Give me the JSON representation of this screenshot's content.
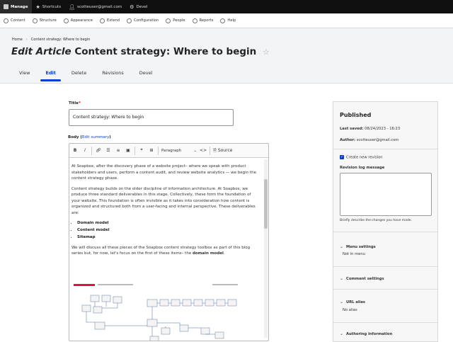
{
  "toolbar": {
    "manage": "Manage",
    "shortcuts": "Shortcuts",
    "user": "scotteuser@gmail.com",
    "devel": "Devel"
  },
  "tray": {
    "items": [
      "Content",
      "Structure",
      "Appearance",
      "Extend",
      "Configuration",
      "People",
      "Reports",
      "Help"
    ]
  },
  "header": {
    "breadcrumb": [
      "Home",
      "Content strategy: Where to begin"
    ],
    "title_prefix": "Edit Article",
    "title": "Content strategy: Where to begin",
    "tabs": [
      "View",
      "Edit",
      "Delete",
      "Revisions",
      "Devel"
    ],
    "active_tab": "Edit"
  },
  "form": {
    "title_label": "Title",
    "title_required": "*",
    "title_value": "Content strategy: Where to begin",
    "body_label": "Body",
    "edit_summary": "Edit summary",
    "format_value": "Paragraph",
    "source_label": "Source",
    "body": {
      "p1": "At Soapbox, after the discovery phase of a website project– where we speak with product stakeholders and users, perform a content audit, and review website analytics — we begin the content strategy phase.",
      "p2": "Content strategy builds on the older discipline of information architecture. At Soapbox, we produce three standard deliverables in this stage. Collectively, these form the foundation of your website. This foundation is often invisible as it takes into consideration how content is organized and structured both from a user-facing and internal perspective. These deliverables are:",
      "list": [
        "Domain model",
        "Content model",
        "Sitemap"
      ],
      "p3_start": "We will discuss all these pieces of the Soapbox content strategy toolbox as part of this blog series but, for now, let's focus on the first of these items– the",
      "p3_bold": "domain model",
      "p3_end": "."
    }
  },
  "sidebar": {
    "status": "Published",
    "last_saved_label": "Last saved:",
    "last_saved": "08/24/2023 - 16:23",
    "author_label": "Author:",
    "author": "scotteuser@gmail.com",
    "create_revision": "Create new revision",
    "revision_log_label": "Revision log message",
    "revision_help": "Briefly describe the changes you have made.",
    "menu_settings": "Menu settings",
    "menu_sub": "Not in menu",
    "comment_settings": "Comment settings",
    "url_alias": "URL alias",
    "url_sub": "No alias",
    "authoring": "Authoring information"
  },
  "colors": {
    "accent": "#003ecc",
    "topbar": "#0f0f0f",
    "header_bg": "#f3f4f6"
  }
}
